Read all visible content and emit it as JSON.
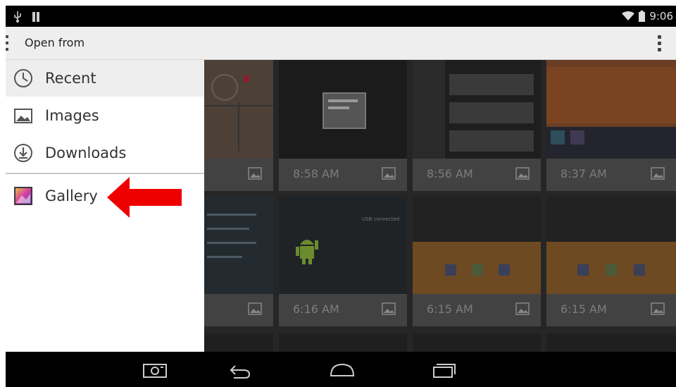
{
  "status_bar": {
    "time": "9:06",
    "left_icons": [
      "usb-icon",
      "notification-icon"
    ],
    "right_icons": [
      "wifi-icon",
      "battery-icon"
    ]
  },
  "action_bar": {
    "title": "Open from"
  },
  "drawer": {
    "items": [
      {
        "label": "Recent",
        "icon": "clock-icon"
      },
      {
        "label": "Images",
        "icon": "image-icon"
      },
      {
        "label": "Downloads",
        "icon": "download-icon"
      },
      {
        "label": "Gallery",
        "icon": "gallery-icon"
      }
    ]
  },
  "grid": {
    "captions": [
      "8:58 AM",
      "8:56 AM",
      "8:37 AM",
      "6:16 AM",
      "6:15 AM",
      "6:15 AM"
    ],
    "toast_text": "USB connected"
  },
  "nav_bar": {
    "buttons": [
      "camera-icon",
      "back-icon",
      "home-icon",
      "recents-icon"
    ]
  },
  "colors": {
    "arrow": "#ee0000",
    "drawer_selected": "#eeeeee",
    "grid_bg": "#262626"
  }
}
